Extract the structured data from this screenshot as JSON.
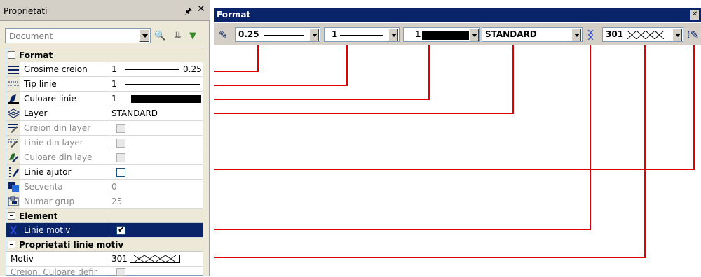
{
  "panel": {
    "title": "Proprietati",
    "pin_icon": "pin-icon",
    "close_icon": "close-icon",
    "document_combo": "Document"
  },
  "sections": {
    "format": "Format",
    "element": "Element",
    "pattern_props": "Proprietati linie motiv"
  },
  "rows": {
    "grosime": {
      "name": "Grosime creion",
      "value": "1",
      "value2": "0.25"
    },
    "tip_linie": {
      "name": "Tip linie",
      "value": "1"
    },
    "culoare": {
      "name": "Culoare linie",
      "value": "1"
    },
    "layer": {
      "name": "Layer",
      "value": "STANDARD"
    },
    "creion_layer": {
      "name": "Creion din layer"
    },
    "linie_layer": {
      "name": "Linie din layer"
    },
    "culoare_layer": {
      "name": "Culoare din laye"
    },
    "linie_ajutor": {
      "name": "Linie ajutor"
    },
    "secventa": {
      "name": "Secventa",
      "value": "0"
    },
    "numar_grup": {
      "name": "Numar grup",
      "value": "25"
    },
    "linie_motiv": {
      "name": "Linie motiv"
    },
    "motiv": {
      "name": "Motiv",
      "value": "301"
    },
    "creion_culoare": {
      "name": "Creion, Culoare defir"
    }
  },
  "toolbar": {
    "title": "Format",
    "pen_value": "0.25",
    "linetype_value": "1",
    "color_value": "1",
    "layer_value": "STANDARD",
    "pattern_value": "301"
  },
  "colors": {
    "title_bar": "#0a246a",
    "connector": "#e00000",
    "panel_bg": "#ece9d8"
  }
}
